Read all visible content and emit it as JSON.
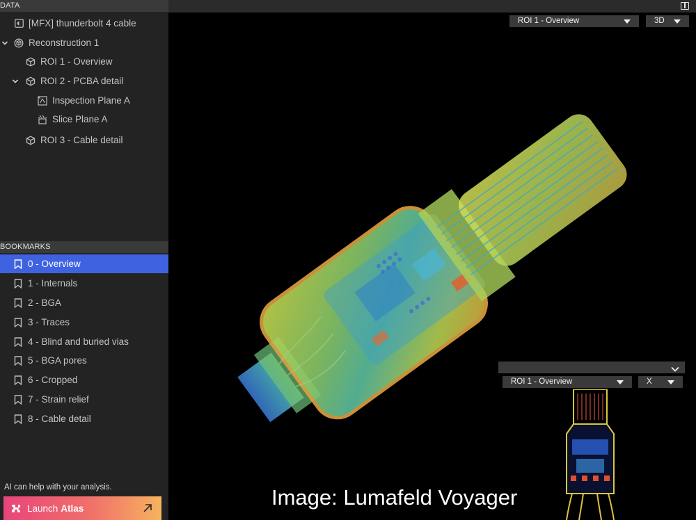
{
  "data_panel": {
    "header": "DATA",
    "items": [
      {
        "label": "[MFX] thunderbolt 4 cable",
        "icon": "volume-file-icon"
      },
      {
        "label": "Reconstruction 1",
        "icon": "reconstruction-icon",
        "expanded": true
      },
      {
        "label": "ROI 1 - Overview",
        "icon": "cube-icon"
      },
      {
        "label": "ROI 2 - PCBA detail",
        "icon": "cube-icon",
        "expanded": true
      },
      {
        "label": "Inspection Plane A",
        "icon": "inspection-plane-icon"
      },
      {
        "label": "Slice Plane A",
        "icon": "slice-plane-icon"
      },
      {
        "label": "ROI 3 - Cable detail",
        "icon": "cube-icon"
      }
    ]
  },
  "bookmarks_panel": {
    "header": "BOOKMARKS",
    "items": [
      {
        "label": "0 - Overview",
        "active": true
      },
      {
        "label": "1 - Internals"
      },
      {
        "label": "2 - BGA"
      },
      {
        "label": "3 - Traces"
      },
      {
        "label": "4 - Blind and buried vias"
      },
      {
        "label": "5 - BGA pores"
      },
      {
        "label": "6 - Cropped"
      },
      {
        "label": "7 - Strain relief"
      },
      {
        "label": "8 - Cable detail"
      }
    ],
    "accent": "#3f63e0"
  },
  "assistant": {
    "prompt": "AI can help with your analysis.",
    "button_prefix": "Launch",
    "button_bold": "Atlas"
  },
  "viewport": {
    "roi_select": "ROI 1 - Overview",
    "view_mode": "3D",
    "mini_view": {
      "top_select": "",
      "roi_select": "ROI 1 - Overview",
      "axis": "X"
    },
    "watermark": "Image: Lumafeld Voyager"
  }
}
